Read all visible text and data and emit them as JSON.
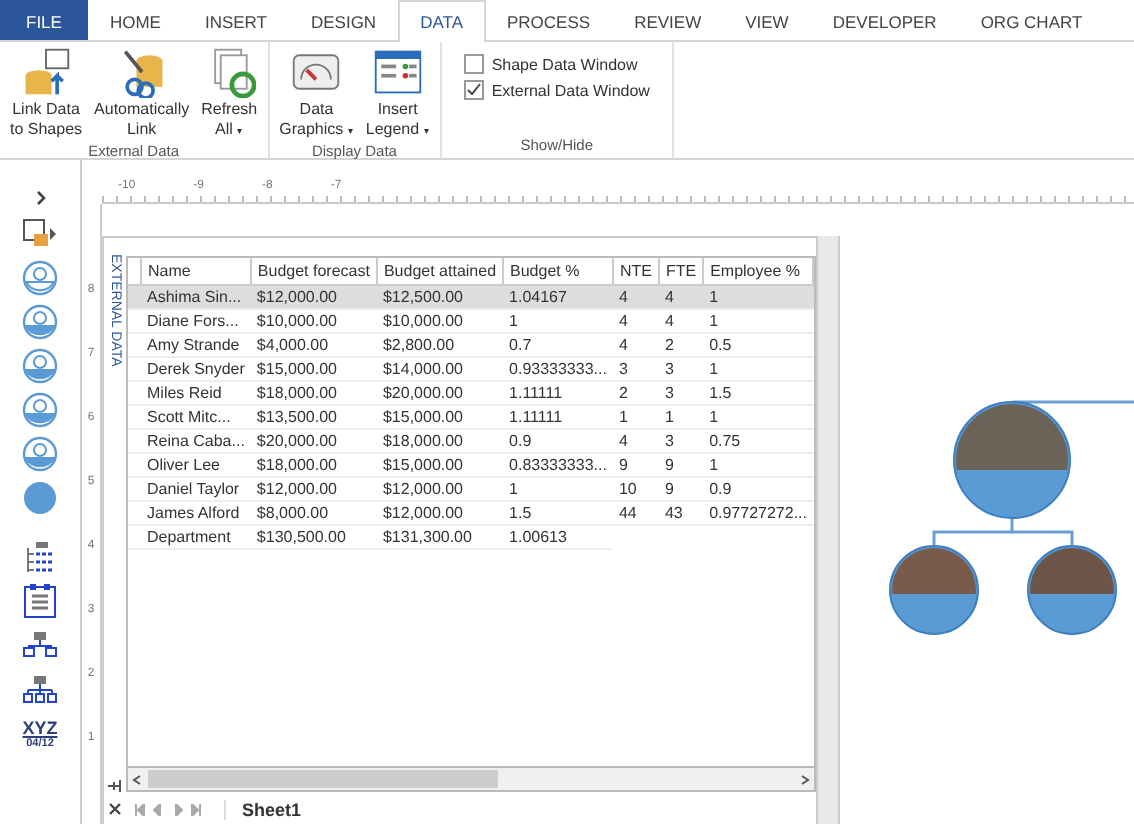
{
  "ribbon_tabs": [
    {
      "label": "FILE",
      "kind": "file",
      "selected": false
    },
    {
      "label": "HOME",
      "kind": "tab",
      "selected": false
    },
    {
      "label": "INSERT",
      "kind": "tab",
      "selected": false
    },
    {
      "label": "DESIGN",
      "kind": "tab",
      "selected": false
    },
    {
      "label": "DATA",
      "kind": "tab",
      "selected": true
    },
    {
      "label": "PROCESS",
      "kind": "tab",
      "selected": false
    },
    {
      "label": "REVIEW",
      "kind": "tab",
      "selected": false
    },
    {
      "label": "VIEW",
      "kind": "tab",
      "selected": false
    },
    {
      "label": "DEVELOPER",
      "kind": "tab",
      "selected": false
    },
    {
      "label": "ORG CHART",
      "kind": "tab",
      "selected": false
    }
  ],
  "ribbon_groups": [
    {
      "label": "External Data",
      "kind": "buttons",
      "buttons": [
        {
          "lines": [
            "Link Data",
            "to Shapes"
          ]
        },
        {
          "lines": [
            "Automatically",
            "Link"
          ]
        },
        {
          "lines": [
            "Refresh",
            "All"
          ],
          "caret": "▾"
        }
      ]
    },
    {
      "label": "Display Data",
      "kind": "buttons",
      "buttons": [
        {
          "lines": [
            "Data",
            "Graphics"
          ],
          "caret": "▾"
        },
        {
          "lines": [
            "Insert",
            "Legend"
          ],
          "caret": "▾"
        }
      ]
    },
    {
      "label": "Show/Hide",
      "kind": "checks",
      "checks": [
        {
          "label": "Shape Data Window",
          "checked": false
        },
        {
          "label": "External Data Window",
          "checked": true
        }
      ]
    }
  ],
  "stencil": {
    "xyz_label": "XYZ",
    "xyz_date": "04/12"
  },
  "top_ruler": [
    "-10",
    "-9",
    "-8",
    "-7"
  ],
  "left_ruler": [
    "8",
    "7",
    "6",
    "5",
    "4",
    "3",
    "2",
    "1"
  ],
  "external_data": {
    "title": "EXTERNAL DATA",
    "columns": [
      "Name",
      "Budget forecast",
      "Budget attained",
      "Budget %",
      "NTE",
      "FTE",
      "Employee %"
    ],
    "rows": [
      {
        "selected": true,
        "cells": [
          "Ashima Sin...",
          "$12,000.00",
          "$12,500.00",
          "1.04167",
          "4",
          "4",
          "1"
        ]
      },
      {
        "selected": false,
        "cells": [
          "Diane Fors...",
          "$10,000.00",
          "$10,000.00",
          "1",
          "4",
          "4",
          "1"
        ]
      },
      {
        "selected": false,
        "cells": [
          "Amy Strande",
          "$4,000.00",
          "$2,800.00",
          "0.7",
          "4",
          "2",
          "0.5"
        ]
      },
      {
        "selected": false,
        "cells": [
          "Derek Snyder",
          "$15,000.00",
          "$14,000.00",
          "0.93333333...",
          "3",
          "3",
          "1"
        ]
      },
      {
        "selected": false,
        "cells": [
          "Miles Reid",
          "$18,000.00",
          "$20,000.00",
          "1.11111",
          "2",
          "3",
          "1.5"
        ]
      },
      {
        "selected": false,
        "cells": [
          "Scott Mitc...",
          "$13,500.00",
          "$15,000.00",
          "1.11111",
          "1",
          "1",
          "1"
        ]
      },
      {
        "selected": false,
        "cells": [
          "Reina Caba...",
          "$20,000.00",
          "$18,000.00",
          "0.9",
          "4",
          "3",
          "0.75"
        ]
      },
      {
        "selected": false,
        "cells": [
          "Oliver Lee",
          "$18,000.00",
          "$15,000.00",
          "0.83333333...",
          "9",
          "9",
          "1"
        ]
      },
      {
        "selected": false,
        "cells": [
          "Daniel Taylor",
          "$12,000.00",
          "$12,000.00",
          "1",
          "10",
          "9",
          "0.9"
        ]
      },
      {
        "selected": false,
        "cells": [
          "James Alford",
          "$8,000.00",
          "$12,000.00",
          "1.5",
          "44",
          "43",
          "0.97727272..."
        ]
      },
      {
        "selected": false,
        "cells": [
          "Department",
          "$130,500.00",
          "$131,300.00",
          "1.00613"
        ]
      }
    ],
    "sheet_tab": "Sheet1"
  }
}
